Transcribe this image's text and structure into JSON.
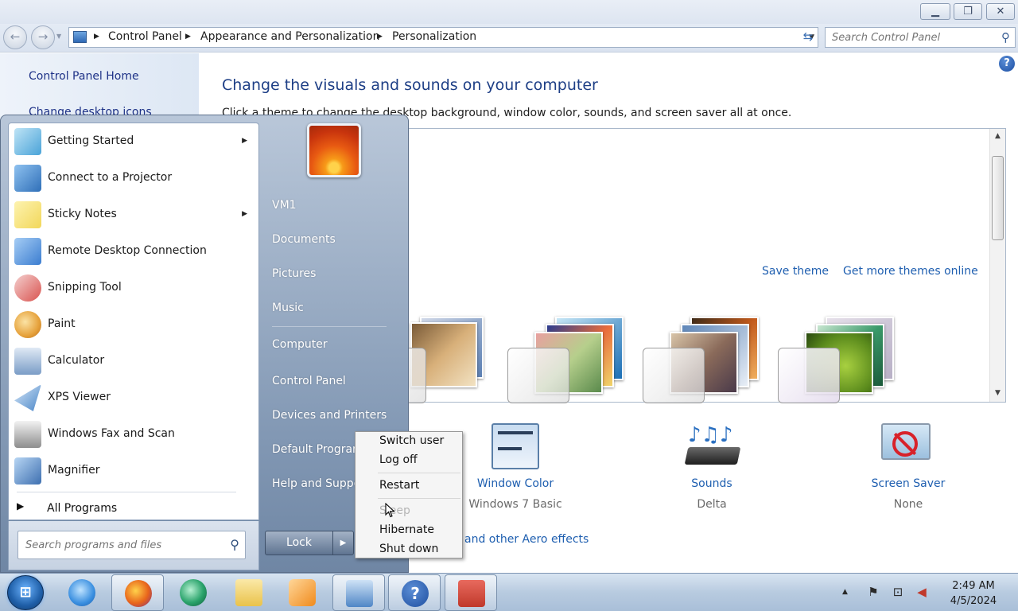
{
  "window": {
    "minimize_icon": "minimize-icon",
    "maximize_icon": "restore-icon",
    "close_icon": "close-icon"
  },
  "navbar": {
    "breadcrumbs": [
      "Control Panel",
      "Appearance and Personalization",
      "Personalization"
    ],
    "search_placeholder": "Search Control Panel"
  },
  "left_pane": {
    "links": [
      "Control Panel Home",
      "Change desktop icons"
    ]
  },
  "main": {
    "heading": "Change the visuals and sounds on your computer",
    "description": "Click a theme to change the desktop background, window color, sounds, and screen saver all at once.",
    "save_theme": "Save theme",
    "get_more_themes": "Get more themes online",
    "bottom_items": [
      {
        "label": "Window Color",
        "sub": "Windows 7 Basic"
      },
      {
        "label": "Sounds",
        "sub": "Delta"
      },
      {
        "label": "Screen Saver",
        "sub": "None"
      }
    ],
    "aero_link": "and other Aero effects"
  },
  "start_menu": {
    "programs": [
      {
        "name": "Getting Started",
        "submenu": true,
        "color": "#4aa3d8"
      },
      {
        "name": "Connect to a Projector",
        "submenu": false,
        "color": "#2f6fb8"
      },
      {
        "name": "Sticky Notes",
        "submenu": true,
        "color": "#f2d75a"
      },
      {
        "name": "Remote Desktop Connection",
        "submenu": false,
        "color": "#3b7dd0"
      },
      {
        "name": "Snipping Tool",
        "submenu": false,
        "color": "#d9534f"
      },
      {
        "name": "Paint",
        "submenu": false,
        "color": "#e6a23c"
      },
      {
        "name": "Calculator",
        "submenu": false,
        "color": "#7a9cc6"
      },
      {
        "name": "XPS Viewer",
        "submenu": false,
        "color": "#4a86c8"
      },
      {
        "name": "Windows Fax and Scan",
        "submenu": false,
        "color": "#8d8d8d"
      },
      {
        "name": "Magnifier",
        "submenu": false,
        "color": "#3d6fb0"
      }
    ],
    "all_programs": "All Programs",
    "search_placeholder": "Search programs and files",
    "places": [
      "VM1",
      "Documents",
      "Pictures",
      "Music",
      "Computer",
      "Control Panel",
      "Devices and Printers",
      "Default Programs",
      "Help and Support"
    ],
    "lock_label": "Lock"
  },
  "shutdown_menu": {
    "items": [
      {
        "label": "Switch user",
        "disabled": false
      },
      {
        "label": "Log off",
        "disabled": false
      },
      {
        "label": "Restart",
        "disabled": false
      },
      {
        "label": "Sleep",
        "disabled": true
      },
      {
        "label": "Hibernate",
        "disabled": false
      },
      {
        "label": "Shut down",
        "disabled": false
      }
    ]
  },
  "taskbar": {
    "apps": [
      {
        "name": "internet-explorer-icon",
        "color": "#3a8fe0"
      },
      {
        "name": "firefox-icon",
        "color": "#e8641b"
      },
      {
        "name": "app-bubble-icon",
        "color": "#2aa36b"
      },
      {
        "name": "file-explorer-icon",
        "color": "#e9c24a"
      },
      {
        "name": "media-player-icon",
        "color": "#f08a1c"
      },
      {
        "name": "control-panel-icon",
        "color": "#4f86c6"
      },
      {
        "name": "help-icon",
        "color": "#1f4fa0"
      },
      {
        "name": "toolbox-icon",
        "color": "#c0392b"
      }
    ],
    "time": "2:49 AM",
    "date": "4/5/2024"
  }
}
